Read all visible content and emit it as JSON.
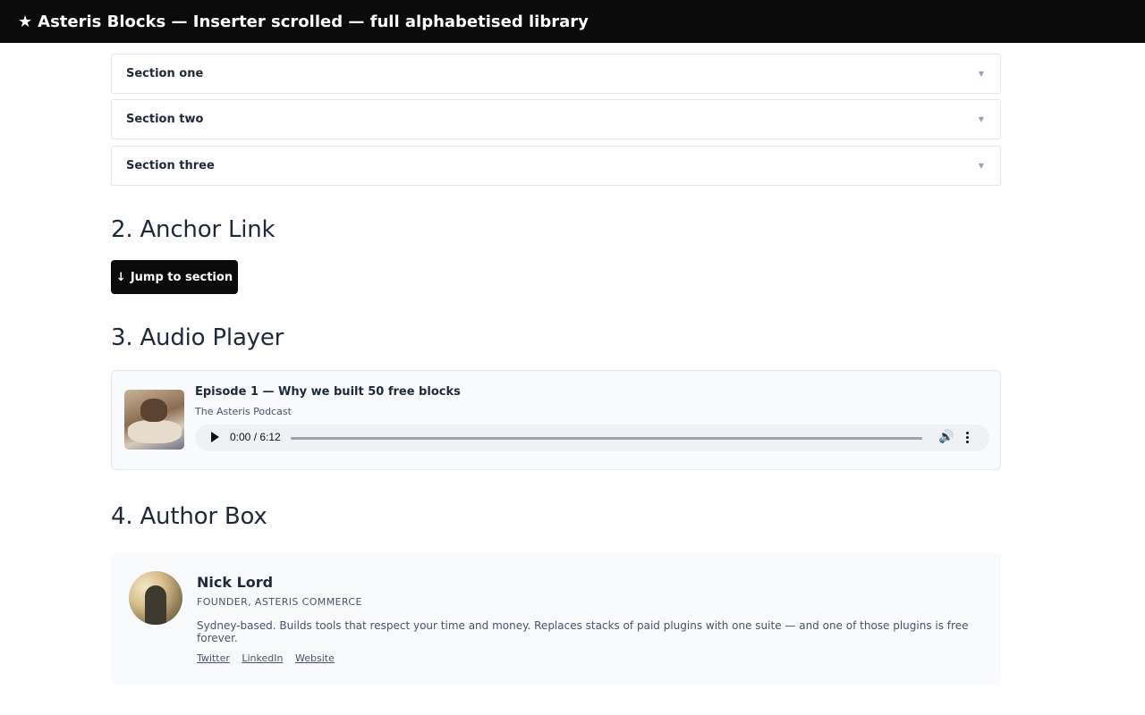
{
  "header": {
    "title": "Asteris Blocks — Inserter scrolled — full alphabetised library",
    "icon": "star-icon"
  },
  "accordion": {
    "items": [
      {
        "label": "Section one"
      },
      {
        "label": "Section two"
      },
      {
        "label": "Section three"
      }
    ]
  },
  "anchor_link": {
    "heading": "2. Anchor Link",
    "button_label": "Jump to section",
    "button_arrow": "↓"
  },
  "audio_player": {
    "heading": "3. Audio Player",
    "episode_title": "Episode 1 — Why we built 50 free blocks",
    "podcast_name": "The Asteris Podcast",
    "time": "0:00 / 6:12"
  },
  "author_box": {
    "heading": "4. Author Box",
    "name": "Nick Lord",
    "role": "FOUNDER, ASTERIS COMMERCE",
    "bio": "Sydney-based. Builds tools that respect your time and money. Replaces stacks of paid plugins with one suite — and one of those plugins is free forever.",
    "links": [
      "Twitter",
      "LinkedIn",
      "Website"
    ]
  }
}
